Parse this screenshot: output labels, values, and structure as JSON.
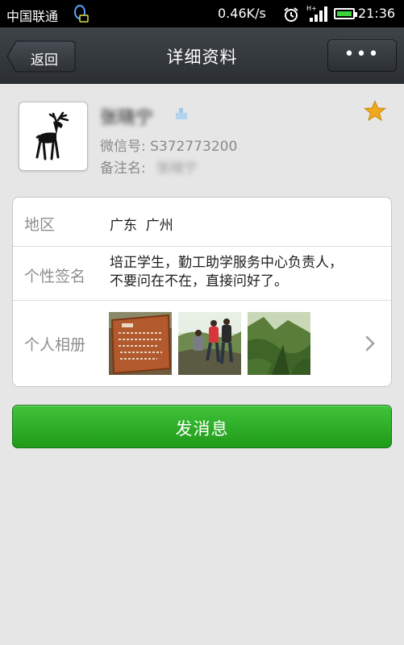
{
  "status_bar": {
    "carrier": "中国联通",
    "net_speed": "0.46K/s",
    "network_type": "H+",
    "time": "21:36",
    "battery_color": "#3bd23b"
  },
  "header": {
    "back_label": "返回",
    "title": "详细资料",
    "more_label": "•••"
  },
  "profile": {
    "nickname": "张晓宁",
    "wechat_id": "微信号: S372773200",
    "remark_label": "备注名:",
    "remark_value": "张晓宁",
    "starred": true,
    "star_color": "#f0a91c"
  },
  "details": {
    "region": {
      "label": "地区",
      "value": "广东  广州"
    },
    "signature": {
      "label": "个性签名",
      "line1": "培正学生，勤工助学服务中心负责人，",
      "line2": "不要问在不在，直接问好了。"
    },
    "album": {
      "label": "个人相册",
      "photos": [
        "wooden-sign-photo",
        "hikers-photo",
        "forest-valley-photo"
      ]
    }
  },
  "actions": {
    "send_label": "发消息",
    "send_color": "#2aa824"
  }
}
